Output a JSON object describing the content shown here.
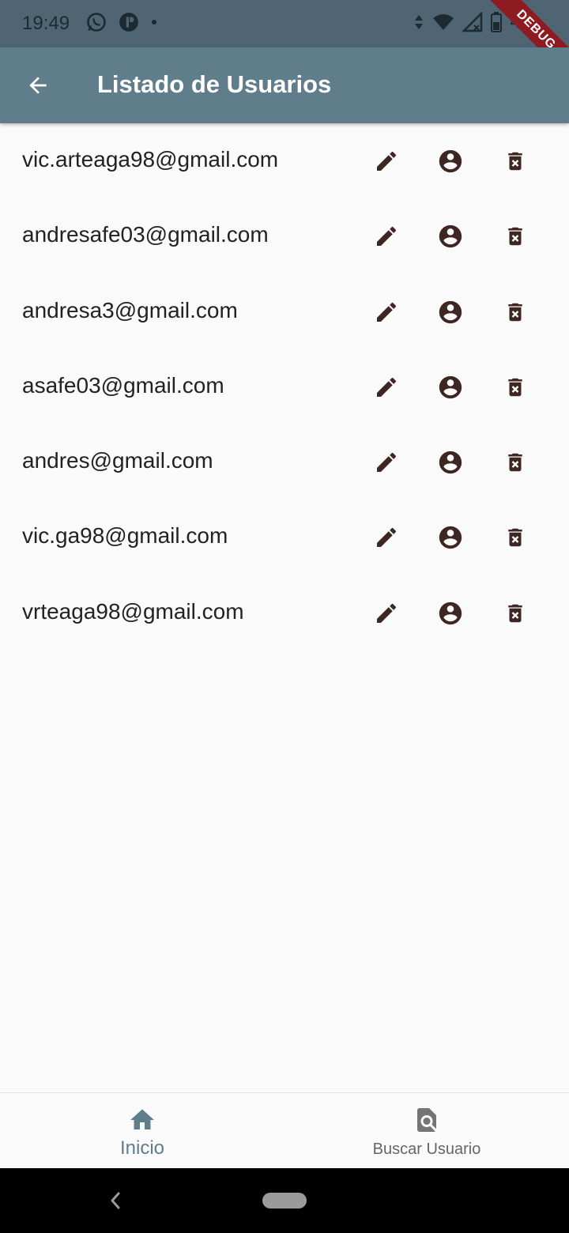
{
  "status_bar": {
    "time": "19:49",
    "battery": "4%"
  },
  "debug_banner": "DEBUG",
  "app_bar": {
    "title": "Listado de Usuarios"
  },
  "users": [
    {
      "email": "vic.arteaga98@gmail.com"
    },
    {
      "email": "andresafe03@gmail.com"
    },
    {
      "email": "andresa3@gmail.com"
    },
    {
      "email": "asafe03@gmail.com"
    },
    {
      "email": "andres@gmail.com"
    },
    {
      "email": "vic.ga98@gmail.com"
    },
    {
      "email": "vrteaga98@gmail.com"
    }
  ],
  "row_icons": [
    "edit-icon",
    "account-circle-icon",
    "delete-icon"
  ],
  "bottom_nav": {
    "items": [
      {
        "label": "Inicio",
        "icon": "home-icon",
        "selected": true
      },
      {
        "label": "Buscar Usuario",
        "icon": "find-in-page-icon",
        "selected": false
      }
    ]
  },
  "colors": {
    "app_bar": "#607d8b",
    "status_bar": "#4f6573",
    "icon": "#3e2723",
    "selected_nav": "#607d8b",
    "debug": "#8e1b22"
  }
}
